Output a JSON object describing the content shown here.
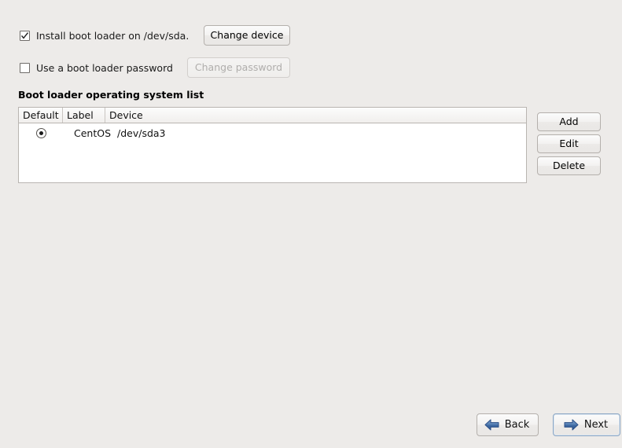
{
  "options": {
    "install_bootloader": {
      "label": "Install boot loader on /dev/sda.",
      "checked": true,
      "button_label": "Change device"
    },
    "bootloader_password": {
      "label": "Use a boot loader password",
      "checked": false,
      "button_label": "Change password",
      "button_disabled": true
    }
  },
  "os_list": {
    "heading": "Boot loader operating system list",
    "columns": [
      "Default",
      "Label",
      "Device"
    ],
    "rows": [
      {
        "default": true,
        "label": "CentOS",
        "device": "/dev/sda3"
      }
    ],
    "actions": {
      "add": "Add",
      "edit": "Edit",
      "delete": "Delete"
    }
  },
  "navigation": {
    "back": "Back",
    "next": "Next"
  },
  "colors": {
    "background": "#edebe9",
    "arrow_blue": "#39629f",
    "focus_border": "#8ba6c4"
  }
}
